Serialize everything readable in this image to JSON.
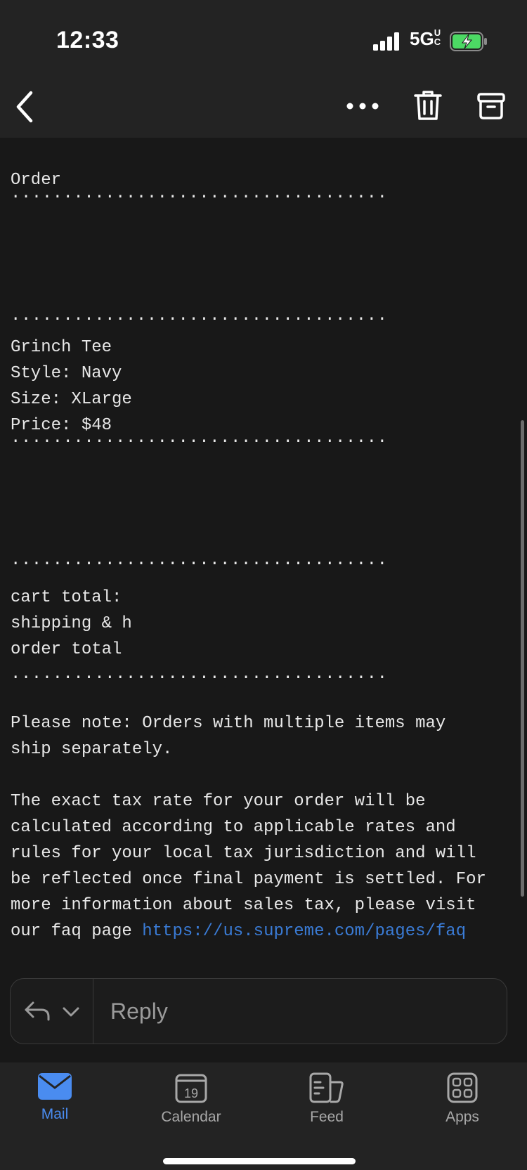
{
  "status_bar": {
    "time": "12:33",
    "network": "5G",
    "network_suffix": "UC",
    "signal_icon": "signal-bars-icon",
    "battery_icon": "battery-charging-icon"
  },
  "toolbar": {
    "back_icon": "chevron-left-icon",
    "more_icon": "ellipsis-icon",
    "delete_icon": "trash-icon",
    "archive_icon": "archive-icon"
  },
  "email": {
    "heading": "Order",
    "divider": "....................................",
    "item": {
      "name": "Grinch Tee",
      "style": "Style: Navy",
      "size": "Size: XLarge",
      "price": "Price: $48"
    },
    "totals": {
      "cart_total": "cart total:",
      "shipping": "shipping & h",
      "order_total": "order total"
    },
    "note_lines": [
      "Please note: Orders with multiple items may",
      "ship separately."
    ],
    "tax_lines": [
      "The exact tax rate for your order will be",
      "calculated according to applicable rates and",
      "rules for your local tax jurisdiction and will",
      "be reflected once final payment is settled. For",
      "more information about sales tax, please visit"
    ],
    "tax_last_prefix": "our faq page ",
    "tax_last_link": "https://us.supreme.com/pages/faq"
  },
  "reply": {
    "placeholder": "Reply",
    "reply_icon": "reply-arrow-icon",
    "chevron_icon": "chevron-down-icon"
  },
  "tabs": [
    {
      "label": "Mail",
      "icon": "mail-icon",
      "active": true
    },
    {
      "label": "Calendar",
      "icon": "calendar-icon",
      "badge": "19"
    },
    {
      "label": "Feed",
      "icon": "feed-icon"
    },
    {
      "label": "Apps",
      "icon": "apps-grid-icon"
    }
  ],
  "colors": {
    "accent": "#4a8cf0",
    "link": "#3a7bd5",
    "background": "#181818",
    "header": "#232323"
  }
}
